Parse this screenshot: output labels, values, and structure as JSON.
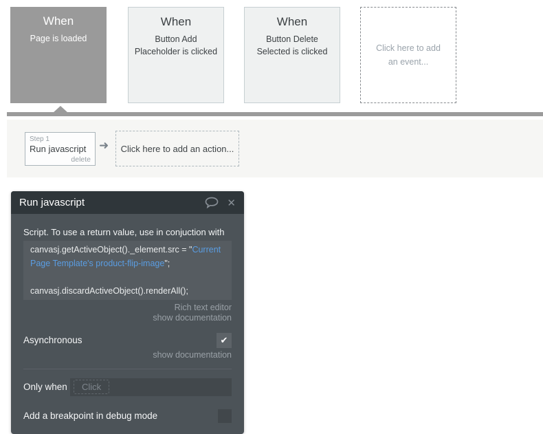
{
  "colors": {
    "accent_blue": "#5a9de2",
    "selected_gray": "#9a9a9a",
    "panel_header": "#2f363a",
    "panel_body": "#4c5358",
    "code_bg": "#565c61"
  },
  "events": [
    {
      "title": "When",
      "subtitle": "Page is loaded",
      "selected": true
    },
    {
      "title": "When",
      "subtitle": "Button Add Placeholder is clicked",
      "selected": false
    },
    {
      "title": "When",
      "subtitle": "Button Delete Selected is clicked",
      "selected": false
    }
  ],
  "add_event_label": "Click here to add an event...",
  "steps": {
    "step_label": "Step 1",
    "action_name": "Run javascript",
    "delete_label": "delete",
    "arrow_glyph": "➜",
    "add_action_label": "Click here to add an action..."
  },
  "panel": {
    "title": "Run javascript",
    "close_glyph": "✕",
    "script_label": "Script. To use a return value, use in conjuction with",
    "code": {
      "line1_static": "canvasj.getActiveObject()._element.src = \"",
      "line1_dynamic": "Current",
      "line2_dynamic": "Page Template's product-flip-image",
      "line2_static": "\";",
      "line3": "",
      "line4": "canvasj.discardActiveObject().renderAll();"
    },
    "rich_text_editor_label": "Rich text editor",
    "show_documentation_label": "show documentation",
    "asynchronous_label": "Asynchronous",
    "asynchronous_check_glyph": "✔",
    "show_documentation_label_2": "show documentation",
    "only_when_label": "Only when",
    "only_when_placeholder": "Click",
    "breakpoint_label": "Add a breakpoint in debug mode"
  }
}
